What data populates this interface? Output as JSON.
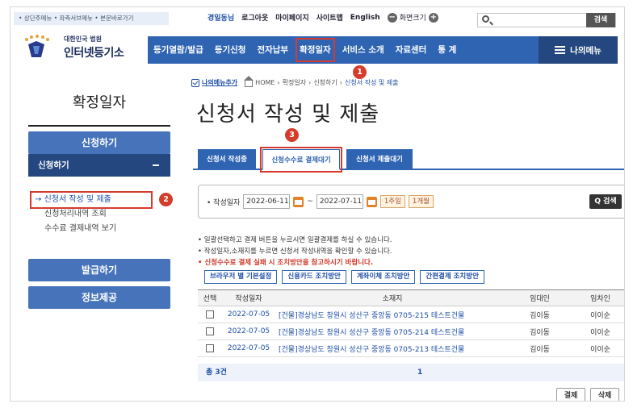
{
  "topbar": {
    "skip_links": "• 상단주메뉴 • 좌측서브메뉴 • 본문바로가기",
    "user_name": "경일동님",
    "logout": "로그아웃",
    "mypage": "마이페이지",
    "sitemap": "사이트맵",
    "english": "English",
    "zoom_label": "화면크기",
    "zoom_minus": "−",
    "zoom_plus": "+",
    "search_button": "검색"
  },
  "logo": {
    "small": "대한민국 법원",
    "big": "인터넷등기소"
  },
  "nav": {
    "items": [
      "등기열람/발급",
      "등기신청",
      "전자납부",
      "확정일자",
      "서비스 소개",
      "자료센터",
      "통 계"
    ],
    "my_menu": "나의메뉴"
  },
  "badges": [
    "1",
    "2",
    "3"
  ],
  "sidebar": {
    "title": "확정일자",
    "apply": "신청하기",
    "apply_sub": "신청하기",
    "links": [
      "신청서 작성 및 제출",
      "신청처리내역 조회",
      "수수료 결제내역 보기"
    ],
    "arrow": "→",
    "issue": "발급하기",
    "info": "정보제공"
  },
  "breadcrumb": {
    "favorite": "나의메뉴추가",
    "home": "HOME",
    "sep": "›",
    "level1": "확정일자",
    "level2": "신청하기",
    "current": "신청서 작성 및 제출"
  },
  "page_title": "신청서 작성 및 제출",
  "tabs": [
    "신청서 작성중",
    "신청수수료 결제대기",
    "신청서 제출대기"
  ],
  "search": {
    "label": "• 작성일자",
    "date_from": "2022-06-11",
    "tilde": "~",
    "date_to": "2022-07-11",
    "week": "1주일",
    "month": "1개월",
    "button": "Q 검색"
  },
  "notes": {
    "line1": "• 일괄선택하고 결제 버튼을 누르시면 일괄결제를 하실 수 있습니다.",
    "line2": "• 작성일자,소재지를 누르면 신청서 작성내역을 확인할 수 있습니다.",
    "line3": "• 신청수수료 결제 실패 시 조치방안을 참고하시기 바랍니다."
  },
  "action_buttons": [
    "브라우저 별 기본설정",
    "신용카드 조치방안",
    "계좌이체 조치방안",
    "간편결제 조치방안"
  ],
  "table": {
    "headers": [
      "선택",
      "작성일자",
      "소재지",
      "임대인",
      "임차인"
    ],
    "rows": [
      {
        "date": "2022-07-05",
        "address": "[건물]경상남도 창원시 성산구 중앙동 0705-215 테스트건물",
        "lessor": "김이동",
        "lessee": "이이순"
      },
      {
        "date": "2022-07-05",
        "address": "[건물]경상남도 창원시 성산구 중앙동 0705-214 테스트건물",
        "lessor": "김이동",
        "lessee": "이이순"
      },
      {
        "date": "2022-07-05",
        "address": "[건물]경상남도 창원시 성산구 중앙동 0705-213 테스트건물",
        "lessor": "김이동",
        "lessee": "이이순"
      }
    ]
  },
  "footer": {
    "count": "총 3건",
    "page": "1"
  },
  "bottom_buttons": {
    "pay": "결제",
    "delete": "삭제"
  },
  "colors": {
    "primary": "#2f64b3",
    "dark": "#24477f",
    "highlight": "#d63b2f"
  }
}
